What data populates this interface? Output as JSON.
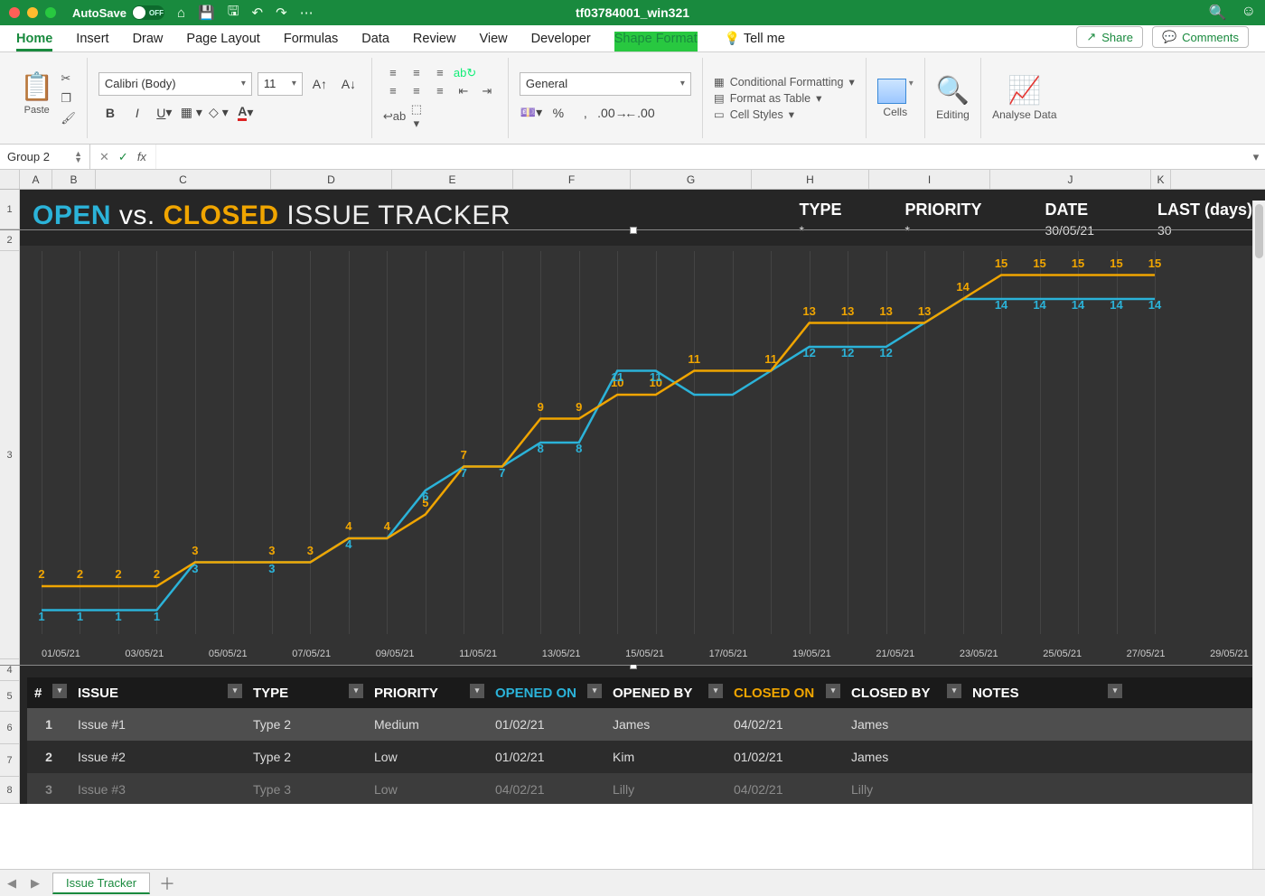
{
  "window": {
    "title": "tf03784001_win321",
    "autosave": "AutoSave",
    "autosave_state": "OFF"
  },
  "menu": {
    "home": "Home",
    "insert": "Insert",
    "draw": "Draw",
    "pagelayout": "Page Layout",
    "formulas": "Formulas",
    "data": "Data",
    "review": "Review",
    "view": "View",
    "developer": "Developer",
    "shapeformat": "Shape Format",
    "tellme": "Tell me",
    "share": "Share",
    "comments": "Comments"
  },
  "ribbon": {
    "paste": "Paste",
    "font": "Calibri (Body)",
    "size": "11",
    "general": "General",
    "condfmt": "Conditional Formatting",
    "fmttable": "Format as Table",
    "cellstyles": "Cell Styles",
    "cells": "Cells",
    "editing": "Editing",
    "analyse": "Analyse Data"
  },
  "namebox": "Group 2",
  "cols": [
    "A",
    "B",
    "C",
    "D",
    "E",
    "F",
    "G",
    "H",
    "I",
    "J",
    "K"
  ],
  "rows": [
    "1",
    "2",
    "3",
    "4",
    "5",
    "6",
    "7",
    "8"
  ],
  "tracker": {
    "open": "OPEN",
    "vs": "vs.",
    "closed": "CLOSED",
    "rest": " ISSUE TRACKER",
    "type_h": "TYPE",
    "type_v": "*",
    "prio_h": "PRIORITY",
    "prio_v": "*",
    "date_h": "DATE",
    "date_v": "30/05/21",
    "last_h": "LAST (days)",
    "last_v": "30"
  },
  "chart_data": {
    "type": "line",
    "x_ticks": [
      "01/05/21",
      "03/05/21",
      "05/05/21",
      "07/05/21",
      "09/05/21",
      "11/05/21",
      "13/05/21",
      "15/05/21",
      "17/05/21",
      "19/05/21",
      "21/05/21",
      "23/05/21",
      "25/05/21",
      "27/05/21",
      "29/05/21"
    ],
    "ylim": [
      0,
      16
    ],
    "series": [
      {
        "name": "Open",
        "color": "#2bb3d9",
        "x": [
          1,
          2,
          3,
          4,
          5,
          6,
          7,
          8,
          9,
          10,
          11,
          12,
          13,
          14,
          15,
          16,
          17,
          18,
          19,
          20,
          21,
          22,
          23,
          24,
          25,
          26,
          27,
          28,
          29,
          30
        ],
        "y": [
          1,
          1,
          1,
          1,
          3,
          3,
          3,
          3,
          4,
          4,
          6,
          7,
          7,
          8,
          8,
          11,
          11,
          10,
          10,
          11,
          12,
          12,
          12,
          13,
          14,
          14,
          14,
          14,
          14,
          14
        ]
      },
      {
        "name": "Closed",
        "color": "#f0a500",
        "x": [
          1,
          2,
          3,
          4,
          5,
          6,
          7,
          8,
          9,
          10,
          11,
          12,
          13,
          14,
          15,
          16,
          17,
          18,
          19,
          20,
          21,
          22,
          23,
          24,
          25,
          26,
          27,
          28,
          29,
          30
        ],
        "y": [
          2,
          2,
          2,
          2,
          3,
          3,
          3,
          3,
          4,
          4,
          5,
          7,
          7,
          9,
          9,
          10,
          10,
          11,
          11,
          11,
          13,
          13,
          13,
          13,
          14,
          15,
          15,
          15,
          15,
          15
        ]
      }
    ],
    "data_labels": {
      "blue": [
        [
          1,
          1
        ],
        [
          2,
          1
        ],
        [
          3,
          1
        ],
        [
          4,
          1
        ],
        [
          5,
          3
        ],
        [
          7,
          3
        ],
        [
          9,
          4
        ],
        [
          11,
          6
        ],
        [
          12,
          7
        ],
        [
          13,
          7
        ],
        [
          14,
          8
        ],
        [
          15,
          8
        ],
        [
          16,
          11
        ],
        [
          17,
          11
        ],
        [
          21,
          12
        ],
        [
          22,
          12
        ],
        [
          23,
          12
        ],
        [
          26,
          14
        ],
        [
          27,
          14
        ],
        [
          28,
          14
        ],
        [
          29,
          14
        ],
        [
          30,
          14
        ]
      ],
      "orange": [
        [
          1,
          2
        ],
        [
          2,
          2
        ],
        [
          3,
          2
        ],
        [
          4,
          2
        ],
        [
          5,
          3
        ],
        [
          7,
          3
        ],
        [
          8,
          3
        ],
        [
          9,
          4
        ],
        [
          10,
          4
        ],
        [
          11,
          5
        ],
        [
          12,
          7
        ],
        [
          14,
          9
        ],
        [
          15,
          9
        ],
        [
          16,
          10
        ],
        [
          17,
          10
        ],
        [
          18,
          11
        ],
        [
          20,
          11
        ],
        [
          21,
          13
        ],
        [
          22,
          13
        ],
        [
          23,
          13
        ],
        [
          24,
          13
        ],
        [
          25,
          14
        ],
        [
          26,
          15
        ],
        [
          27,
          15
        ],
        [
          28,
          15
        ],
        [
          29,
          15
        ],
        [
          30,
          15
        ]
      ]
    }
  },
  "table": {
    "headers": {
      "num": "#",
      "issue": "ISSUE",
      "type": "TYPE",
      "priority": "PRIORITY",
      "opened": "OPENED ON",
      "openedby": "OPENED BY",
      "closed": "CLOSED ON",
      "closedby": "CLOSED BY",
      "notes": "NOTES"
    },
    "rows": [
      {
        "n": "1",
        "issue": "Issue #1",
        "type": "Type 2",
        "priority": "Medium",
        "opened": "01/02/21",
        "openedby": "James",
        "closed": "04/02/21",
        "closedby": "James",
        "notes": ""
      },
      {
        "n": "2",
        "issue": "Issue #2",
        "type": "Type 2",
        "priority": "Low",
        "opened": "01/02/21",
        "openedby": "Kim",
        "closed": "01/02/21",
        "closedby": "James",
        "notes": ""
      },
      {
        "n": "3",
        "issue": "Issue #3",
        "type": "Type 3",
        "priority": "Low",
        "opened": "04/02/21",
        "openedby": "Lilly",
        "closed": "04/02/21",
        "closedby": "Lilly",
        "notes": ""
      }
    ]
  },
  "sheettab": "Issue Tracker"
}
